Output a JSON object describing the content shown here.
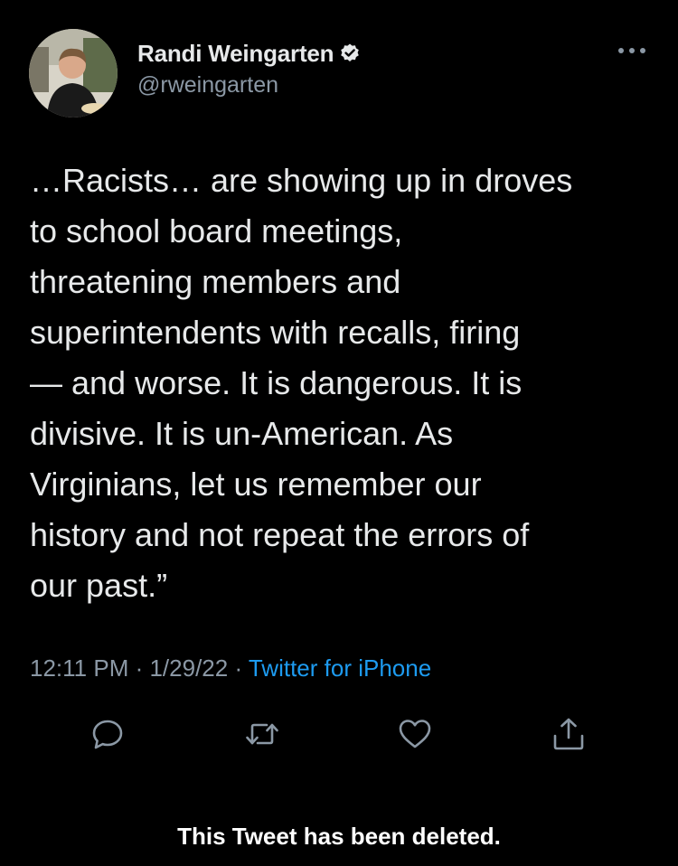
{
  "author": {
    "display_name": "Randi Weingarten",
    "handle": "@rweingarten",
    "verified": true,
    "avatar_icon": "profile-photo"
  },
  "tweet": {
    "text": "…Racists… are showing up in droves\nto school board meetings,\nthreatening members and\nsuperintendents with recalls, firing\n— and worse. It is dangerous. It is\ndivisive. It is un-American. As\nVirginians, let us remember our\nhistory and not repeat the errors of\nour past.”",
    "time": "12:11 PM",
    "separator": " · ",
    "date": "1/29/22",
    "source": "Twitter for iPhone"
  },
  "actions": {
    "reply_icon": "reply-icon",
    "retweet_icon": "retweet-icon",
    "like_icon": "like-icon",
    "share_icon": "share-icon"
  },
  "footer": {
    "deleted_notice": "This Tweet has been deleted."
  },
  "colors": {
    "background": "#000000",
    "text": "#e7e9ea",
    "secondary": "#8b98a5",
    "link": "#1d9bf0"
  }
}
